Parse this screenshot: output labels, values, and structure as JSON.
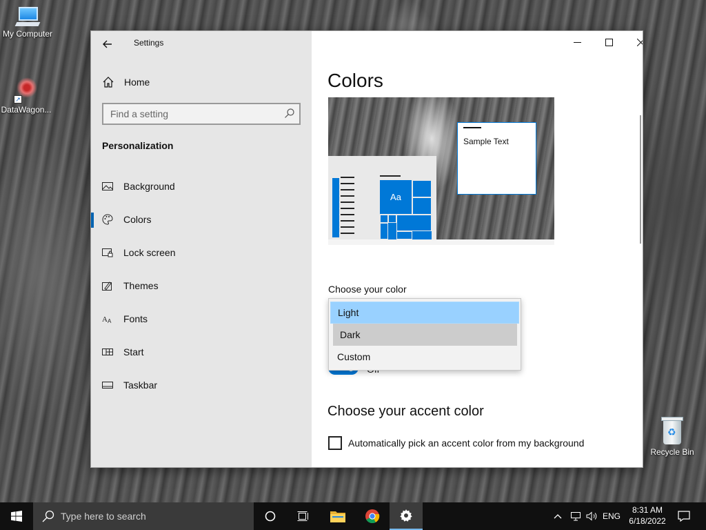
{
  "desktop": {
    "icons": [
      {
        "label": "My Computer"
      },
      {
        "label": "DataWagon..."
      },
      {
        "label": "Recycle Bin"
      }
    ]
  },
  "window": {
    "app_title": "Settings",
    "sidebar": {
      "home_label": "Home",
      "search_placeholder": "Find a setting",
      "section_title": "Personalization",
      "items": [
        {
          "label": "Background",
          "icon": "image-icon"
        },
        {
          "label": "Colors",
          "icon": "palette-icon",
          "active": true
        },
        {
          "label": "Lock screen",
          "icon": "lock-screen-icon"
        },
        {
          "label": "Themes",
          "icon": "themes-icon"
        },
        {
          "label": "Fonts",
          "icon": "fonts-icon"
        },
        {
          "label": "Start",
          "icon": "start-icon"
        },
        {
          "label": "Taskbar",
          "icon": "taskbar-icon"
        }
      ]
    },
    "main": {
      "page_title": "Colors",
      "preview": {
        "tile_text": "Aa",
        "sample_text": "Sample Text"
      },
      "choose_color_label": "Choose your color",
      "color_options": [
        "Light",
        "Dark",
        "Custom"
      ],
      "toggle_state_label": "Off",
      "accent_title": "Choose your accent color",
      "auto_accent_label": "Automatically pick an accent color from my background"
    }
  },
  "taskbar": {
    "search_placeholder": "Type here to search",
    "language": "ENG",
    "time": "8:31 AM",
    "date": "6/18/2022"
  },
  "colors": {
    "accent": "#0078d7",
    "selected_option_bg": "#99d1ff",
    "hover_option_bg": "#cccccc",
    "sidebar_bg": "#e6e6e6",
    "taskbar_bg": "#101010"
  }
}
